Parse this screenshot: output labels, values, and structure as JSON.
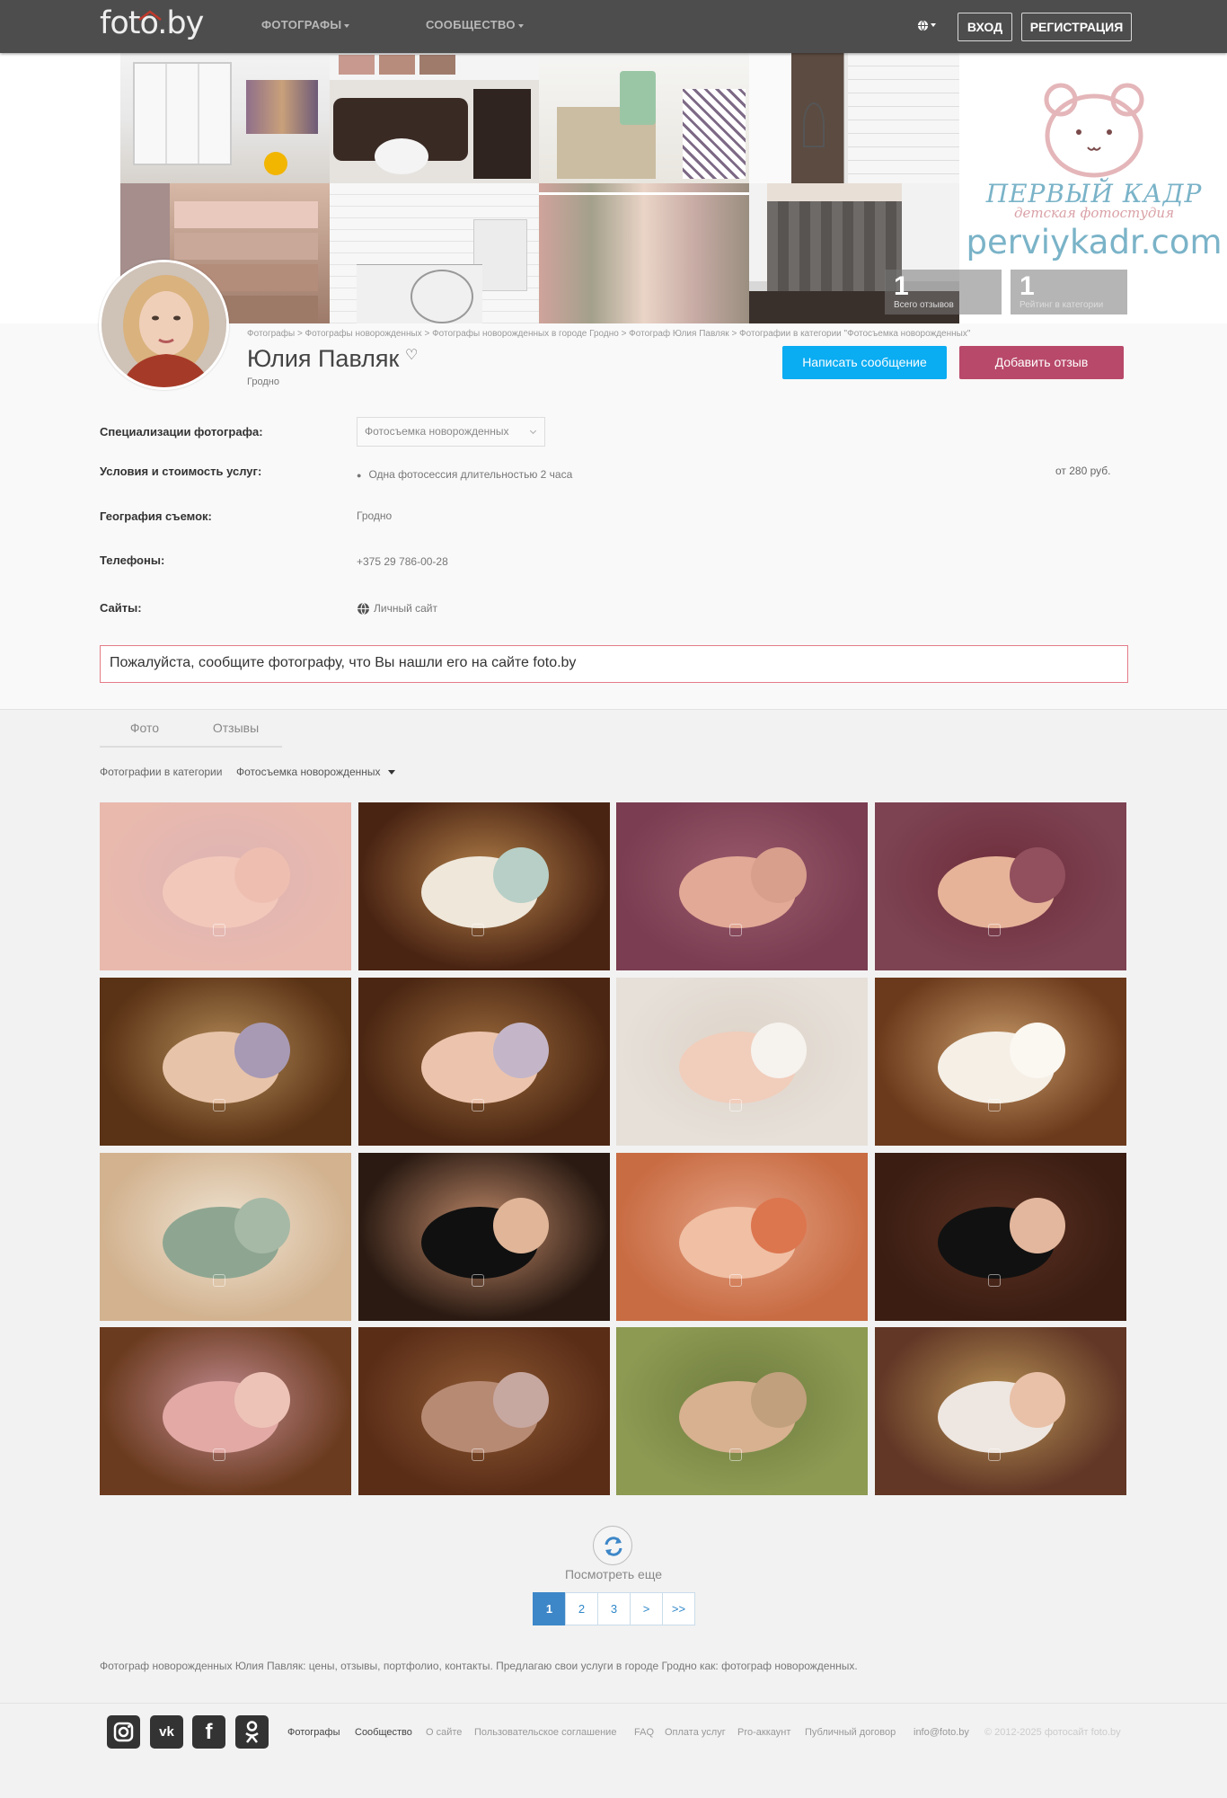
{
  "header": {
    "logo": "foto.by",
    "nav": [
      "ФОТОГРАФЫ",
      "СООБЩЕСТВО"
    ],
    "login_label": "ВХОД",
    "register_label": "РЕГИСТРАЦИЯ"
  },
  "banner": {
    "brand_name": "ПЕРВЫЙ КАДР",
    "brand_sub": "детская фотостудия",
    "brand_url": "perviykadr.com",
    "stats": [
      {
        "value": "1",
        "label": "Всего отзывов"
      },
      {
        "value": "1",
        "label": "Рейтинг в категории"
      }
    ]
  },
  "profile": {
    "breadcrumbs": "Фотографы > Фотографы новорожденных > Фотографы новорожденных в городе Гродно > Фотограф Юлия Павляк > Фотографии в категории \"Фотосъемка новорожденных\"",
    "name": "Юлия Павляк",
    "city": "Гродно",
    "message_button": "Написать сообщение",
    "review_button": "Добавить отзыв",
    "rows": {
      "spec_label": "Специализации фотографа:",
      "spec_value": "Фотосъемка новорожденных",
      "terms_label": "Условия и стоимость услуг:",
      "terms_item": "Одна фотосессия длительностью 2 часа",
      "terms_price": "от 280 руб.",
      "geo_label": "География съемок:",
      "geo_value": "Гродно",
      "phones_label": "Телефоны:",
      "phones_value": "+375 29 786-00-28",
      "sites_label": "Сайты:",
      "sites_value": "Личный сайт"
    },
    "notice": "Пожалуйста, сообщите фотографу, что Вы нашли его на сайте foto.by"
  },
  "tabs": [
    "Фото",
    "Отзывы"
  ],
  "category": {
    "label": "Фотографии в категории",
    "value": "Фотосъемка новорожденных"
  },
  "gallery": {
    "photos": [
      {
        "bg": "#e9b9ad",
        "body": "#f2c8bb",
        "head": "#eebfb1",
        "accent": "#ddb4b4"
      },
      {
        "bg": "#4a2413",
        "body": "#efe7da",
        "head": "#b7cfc7",
        "accent": "#b4814a"
      },
      {
        "bg": "#7a3d51",
        "body": "#e2a996",
        "head": "#d79f8c",
        "accent": "#9a5a6c"
      },
      {
        "bg": "#7d4353",
        "body": "#e6b399",
        "head": "#92505e",
        "accent": "#6e2c3a"
      },
      {
        "bg": "#5a3215",
        "body": "#e7c3a9",
        "head": "#a89ab5",
        "accent": "#b28a57"
      },
      {
        "bg": "#4b2612",
        "body": "#ecc4ad",
        "head": "#c4b6c8",
        "accent": "#9a6a3c"
      },
      {
        "bg": "#e6e0d9",
        "body": "#f1cdbb",
        "head": "#f6f2ee",
        "accent": "#ddd3c8"
      },
      {
        "bg": "#6b3a1c",
        "body": "#f5efe6",
        "head": "#fbf7f1",
        "accent": "#c79a68"
      },
      {
        "bg": "#d2b28f",
        "body": "#8ea691",
        "head": "#a6b9a6",
        "accent": "#efe4d3"
      },
      {
        "bg": "#2a1a12",
        "body": "#101010",
        "head": "#e0b598",
        "accent": "#c08a6a"
      },
      {
        "bg": "#c86c43",
        "body": "#f0bfa4",
        "head": "#dc764f",
        "accent": "#e5a184"
      },
      {
        "bg": "#3b1d12",
        "body": "#111111",
        "head": "#e3b79d",
        "accent": "#5a3122"
      },
      {
        "bg": "#6b3b1f",
        "body": "#e2a9a5",
        "head": "#eec3b7",
        "accent": "#c18a8f"
      },
      {
        "bg": "#5a2d17",
        "body": "#b78a74",
        "head": "#c7a8a0",
        "accent": "#8f5a34"
      },
      {
        "bg": "#8c9a52",
        "body": "#d7b190",
        "head": "#c1a07e",
        "accent": "#6f7c3f"
      },
      {
        "bg": "#623726",
        "body": "#eee6e0",
        "head": "#e9c1a8",
        "accent": "#b99356"
      }
    ]
  },
  "more_label": "Посмотреть еще",
  "pagination": [
    "1",
    "2",
    "3",
    ">",
    ">>"
  ],
  "seo_text": "Фотограф новорожденных Юлия Павляк: цены, отзывы, портфолио, контакты. Предлагаю свои услуги в городе Гродно как: фотограф новорожденных.",
  "footer": {
    "social": [
      "instagram-icon",
      "vk-icon",
      "facebook-icon",
      "odnoklassniki-icon"
    ],
    "links": [
      "Фотографы",
      "Сообщество",
      "О сайте",
      "Пользовательское соглашение",
      "FAQ",
      "Оплата услуг",
      "Pro-аккаунт",
      "Публичный договор",
      "info@foto.by",
      "© 2012-2025 фотосайт foto.by"
    ]
  },
  "colors": {
    "topbar": "#4d4d4d",
    "message_button": "#0aacf2",
    "review_button": "#b8496a",
    "pager_active": "#3d87c8",
    "notice_border": "#e57b88"
  }
}
